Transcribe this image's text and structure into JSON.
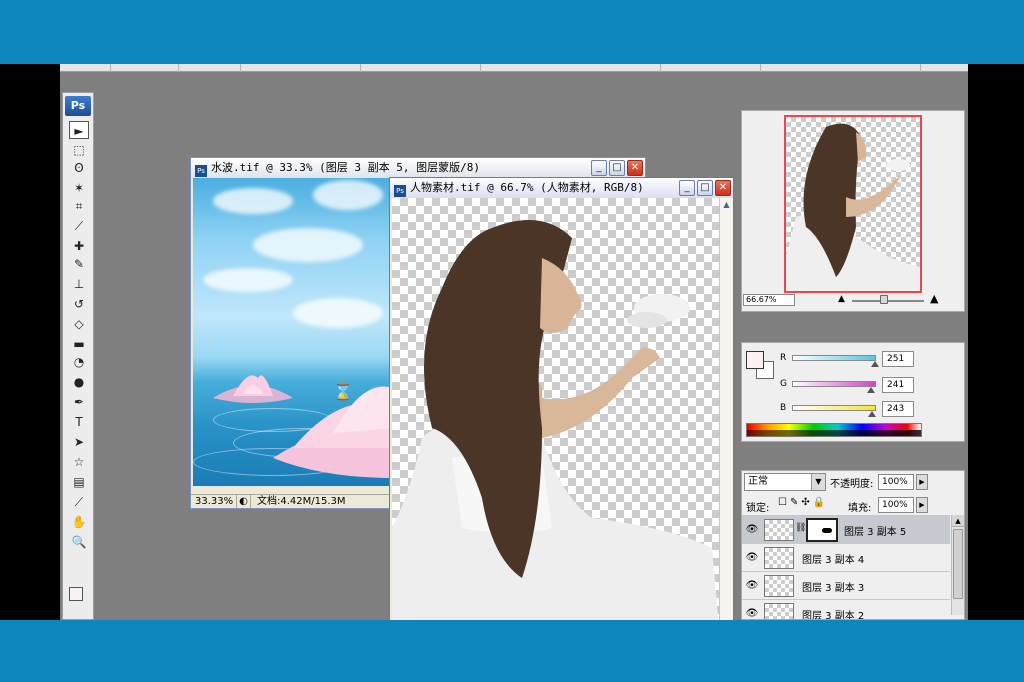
{
  "toolbox": {
    "logo": "Ps",
    "tools": [
      {
        "name": "move-tool",
        "glyph": "►"
      },
      {
        "name": "marquee-tool",
        "glyph": "⬚"
      },
      {
        "name": "lasso-tool",
        "glyph": "ʘ"
      },
      {
        "name": "magic-wand-tool",
        "glyph": "✶"
      },
      {
        "name": "crop-tool",
        "glyph": "⌗"
      },
      {
        "name": "slice-tool",
        "glyph": "⟋"
      },
      {
        "name": "healing-brush-tool",
        "glyph": "✚"
      },
      {
        "name": "brush-tool",
        "glyph": "✎"
      },
      {
        "name": "clone-stamp-tool",
        "glyph": "⊥"
      },
      {
        "name": "history-brush-tool",
        "glyph": "↺"
      },
      {
        "name": "eraser-tool",
        "glyph": "◇"
      },
      {
        "name": "gradient-tool",
        "glyph": "▬"
      },
      {
        "name": "blur-tool",
        "glyph": "◔"
      },
      {
        "name": "dodge-tool",
        "glyph": "●"
      },
      {
        "name": "pen-tool",
        "glyph": "✒"
      },
      {
        "name": "type-tool",
        "glyph": "T"
      },
      {
        "name": "path-selection-tool",
        "glyph": "➤"
      },
      {
        "name": "shape-tool",
        "glyph": "☆"
      },
      {
        "name": "notes-tool",
        "glyph": "▤"
      },
      {
        "name": "eyedropper-tool",
        "glyph": "⟋"
      },
      {
        "name": "hand-tool",
        "glyph": "✋"
      },
      {
        "name": "zoom-tool",
        "glyph": "🔍"
      }
    ]
  },
  "window_water": {
    "title": "水波.tif @ 33.3% (图层 3 副本 5, 图层蒙版/8)",
    "status_zoom": "33.33%",
    "status_doc": "文档:4.42M/15.3M",
    "cursor": "⌛"
  },
  "window_person": {
    "title": "人物素材.tif @ 66.7% (人物素材, RGB/8)"
  },
  "window_buttons": {
    "minimize": "_",
    "maximize": "□",
    "close": "✕"
  },
  "navigator": {
    "zoom": "66.67%"
  },
  "color_panel": {
    "channels": [
      {
        "label": "R",
        "value": "251",
        "level": 0.984
      },
      {
        "label": "G",
        "value": "241",
        "level": 0.945
      },
      {
        "label": "B",
        "value": "243",
        "level": 0.953
      }
    ],
    "colors": {
      "R": "#5bc4e0",
      "G": "#d046c4",
      "B": "#f2e634"
    }
  },
  "layers_panel": {
    "blend_mode": "正常",
    "opacity_label": "不透明度:",
    "opacity_value": "100%",
    "lock_label": "锁定:",
    "fill_label": "填充:",
    "fill_value": "100%",
    "layers": [
      {
        "name": "图层 3 副本 5",
        "selected": true,
        "has_mask": true
      },
      {
        "name": "图层 3 副本 4",
        "selected": false,
        "has_mask": false
      },
      {
        "name": "图层 3 副本 3",
        "selected": false,
        "has_mask": false
      },
      {
        "name": "图层 3 副本 2",
        "selected": false,
        "has_mask": false
      }
    ]
  }
}
